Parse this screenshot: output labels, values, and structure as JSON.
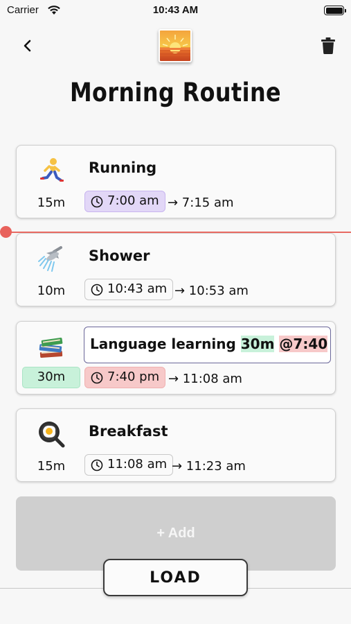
{
  "status_bar": {
    "carrier": "Carrier",
    "time": "10:43 AM"
  },
  "header": {
    "title": "Morning Routine",
    "back_icon": "chevron-left-icon",
    "image_icon": "sunrise-icon",
    "delete_icon": "trash-icon"
  },
  "colors": {
    "timeline": "#e8625c",
    "active_start": "#e2d7f7",
    "conflict": "#f7c9c9",
    "duration_match": "#c8f1da",
    "add_button": "#cfcfcf"
  },
  "tasks": [
    {
      "emoji": "runner-icon",
      "name": "Running",
      "duration": "15m",
      "start": "7:00 am",
      "end": "→ 7:15 am"
    },
    {
      "emoji": "shower-icon",
      "name": "Shower",
      "duration": "10m",
      "start": "10:43 am",
      "end": "→ 10:53 am"
    },
    {
      "emoji": "books-icon",
      "name_prefix": "Language learning ",
      "name_duration": "30m",
      "name_time": "@7:40",
      "duration": "30m",
      "start": "7:40 pm",
      "end": "→ 11:08 am"
    },
    {
      "emoji": "frying-pan-egg-icon",
      "name": "Breakfast",
      "duration": "15m",
      "start": "11:08 am",
      "end": "→ 11:23 am"
    }
  ],
  "add_button": {
    "label": "+ Add"
  },
  "load_button": {
    "label": "LOAD"
  }
}
